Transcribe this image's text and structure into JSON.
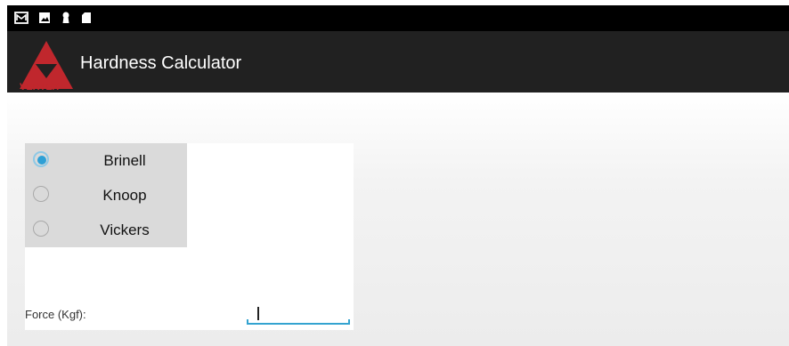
{
  "status_bar": {
    "icons": [
      "mail-icon",
      "image-icon",
      "keyhole-icon",
      "sd-card-icon"
    ]
  },
  "action_bar": {
    "logo_text": "VERTEX",
    "title": "Hardness Calculator"
  },
  "hardness_type": {
    "options": [
      {
        "label": "Brinell",
        "selected": true
      },
      {
        "label": "Knoop",
        "selected": false
      },
      {
        "label": "Vickers",
        "selected": false
      }
    ]
  },
  "force": {
    "label": "Force (Kgf):",
    "value": ""
  },
  "colors": {
    "status_bar": "#000000",
    "action_bar": "#212121",
    "logo_red": "#c0272d",
    "accent": "#2ea0d6",
    "radio_group_bg": "#dadada"
  }
}
